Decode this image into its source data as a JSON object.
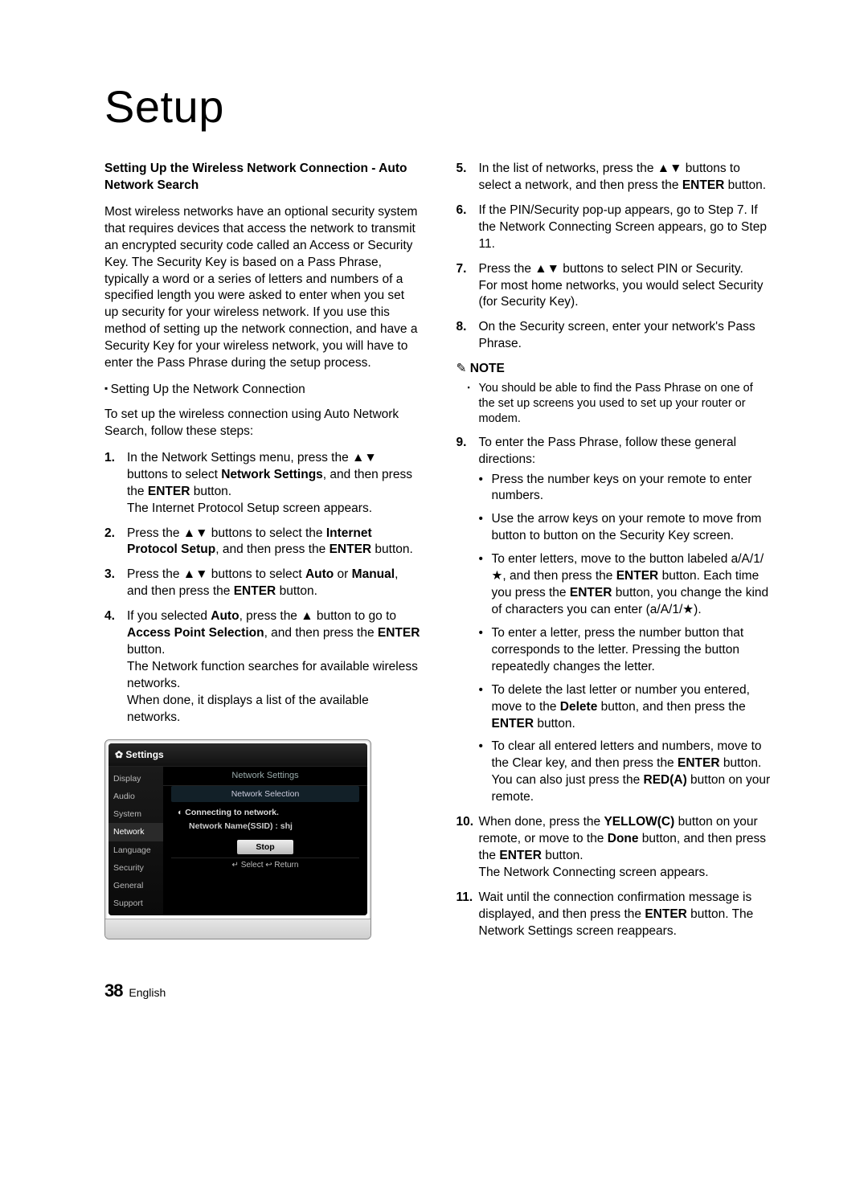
{
  "title": "Setup",
  "left": {
    "section_title": "Setting Up the Wireless Network Connection - Auto Network Search",
    "intro": "Most wireless networks have an optional security system that requires devices that access the network to transmit an encrypted security code called an Access or Security Key. The Security Key is based on a Pass Phrase, typically a word or a series of letters and numbers of a specified length you were asked to enter when you set up security for your wireless network. If you use this method of setting up the network connection, and have a Security Key for your wireless network, you will have to enter the Pass Phrase during the setup process.",
    "sub_heading": "Setting Up the Network Connection",
    "sub_intro": "To set up the wireless connection using Auto Network Search, follow these steps:",
    "steps": [
      {
        "pre": "In the Network Settings menu, press the ▲▼ buttons to select ",
        "b1": "Network Settings",
        "mid1": ", and then press the ",
        "b2": "ENTER",
        "mid2": " button.",
        "tail": "The Internet Protocol Setup screen appears."
      },
      {
        "pre": "Press the ▲▼ buttons to select the ",
        "b1": "Internet Protocol Setup",
        "mid1": ", and then press the ",
        "b2": "ENTER",
        "mid2": " button.",
        "tail": ""
      },
      {
        "pre": "Press the ▲▼ buttons to select ",
        "b1": "Auto",
        "mid1": " or ",
        "b2": "Manual",
        "mid2": ", and then press the ",
        "b3": "ENTER",
        "mid3": " button.",
        "tail": ""
      },
      {
        "pre": "If you selected ",
        "b1": "Auto",
        "mid1": ", press the ▲ button to go to ",
        "b2": "Access Point Selection",
        "mid2": ", and then press the ",
        "b3": "ENTER",
        "mid3": " button.",
        "tail": "The Network function searches for available wireless networks.",
        "tail2": "When done, it displays a list of the available networks."
      }
    ]
  },
  "osd": {
    "window_title": "Settings",
    "side": [
      "Display",
      "Audio",
      "System",
      "Network",
      "Language",
      "Security",
      "General",
      "Support"
    ],
    "active_index": 3,
    "h1": "Network Settings",
    "h2": "Network Selection",
    "line1": "Connecting to network.",
    "line2": "Network Name(SSID) : shj",
    "btn": "Stop",
    "foot": "↵ Select   ↩ Return"
  },
  "right": {
    "steps5to8": [
      {
        "pre": "In the list of networks, press the ▲▼ buttons to select a network, and then press the ",
        "b1": "ENTER",
        "mid1": " button.",
        "tail": ""
      },
      {
        "pre": "If the PIN/Security pop-up appears, go to Step 7. If the Network Connecting Screen appears, go to Step 11.",
        "tail": ""
      },
      {
        "pre": "Press the ▲▼ buttons to select PIN or Security.",
        "tail": "For most home networks, you would select Security (for Security Key)."
      },
      {
        "pre": "On the Security screen, enter your network's Pass Phrase.",
        "tail": ""
      }
    ],
    "note_label": "NOTE",
    "note_item": "You should be able to find the Pass Phrase on one of the set up screens you used to set up your router or modem.",
    "step9_intro": "To enter the Pass Phrase, follow these general directions:",
    "step9_bullets": [
      "Press the number keys on your remote to enter numbers.",
      "Use the arrow keys on your remote to move from button to button on the Security Key screen.",
      {
        "pre": "To enter letters, move to the button labeled a/A/1/★, and then press the ",
        "b1": "ENTER",
        "mid1": " button. Each time you press the ",
        "b2": "ENTER",
        "mid2": " button, you change the kind of characters you can enter (a/A/1/★)."
      },
      "To enter a letter, press the number button that corresponds to the letter. Pressing the button repeatedly changes the letter.",
      {
        "pre": "To delete the last letter or number you entered, move to the ",
        "b1": "Delete",
        "mid1": " button, and then press the ",
        "b2": "ENTER",
        "mid2": " button."
      },
      {
        "pre": "To clear all entered letters and numbers, move to the Clear key, and then press the ",
        "b1": "ENTER",
        "mid1": " button. You can also just press the ",
        "b2": "RED(A)",
        "mid2": " button on your remote."
      }
    ],
    "steps10to11": [
      {
        "pre": "When done, press the ",
        "b1": "YELLOW(C)",
        "mid1": " button on your remote, or move to the ",
        "b2": "Done",
        "mid2": " button, and then press the ",
        "b3": "ENTER",
        "mid3": " button.",
        "tail": "The Network Connecting screen appears."
      },
      {
        "pre": "Wait until the connection confirmation message is displayed, and then press the ",
        "b1": "ENTER",
        "mid1": " button. The Network Settings screen reappears.",
        "tail": ""
      }
    ]
  },
  "footer": {
    "page": "38",
    "lang": "English"
  }
}
